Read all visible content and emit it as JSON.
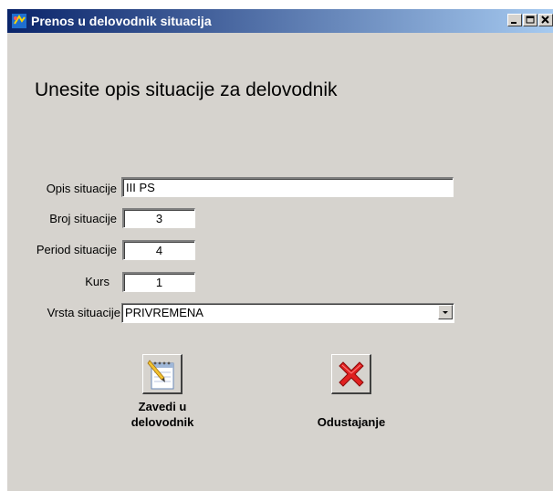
{
  "window": {
    "title": "Prenos u delovodnik situacija",
    "controls": {
      "minimize": "minimize",
      "maximize": "maximize",
      "close": "close"
    }
  },
  "heading": "Unesite opis situacije za delovodnik",
  "form": {
    "opis": {
      "label": "Opis situacije",
      "value": "III PS"
    },
    "broj": {
      "label": "Broj situacije",
      "value": "3"
    },
    "period": {
      "label": "Period situacije",
      "value": "4"
    },
    "kurs": {
      "label": "Kurs",
      "value": "1"
    },
    "vrsta": {
      "label": "Vrsta situacije",
      "value": "PRIVREMENA"
    }
  },
  "buttons": {
    "zavedi": {
      "label_line1": "Zavedi u",
      "label_line2": "delovodnik",
      "icon": "notepad-pencil-icon"
    },
    "odustajanje": {
      "label": "Odustajanje",
      "icon": "red-x-icon"
    }
  },
  "colors": {
    "window_bg": "#d6d3ce",
    "titlebar_start": "#0a246a",
    "titlebar_end": "#a6caf0",
    "cancel_red": "#e02020"
  }
}
